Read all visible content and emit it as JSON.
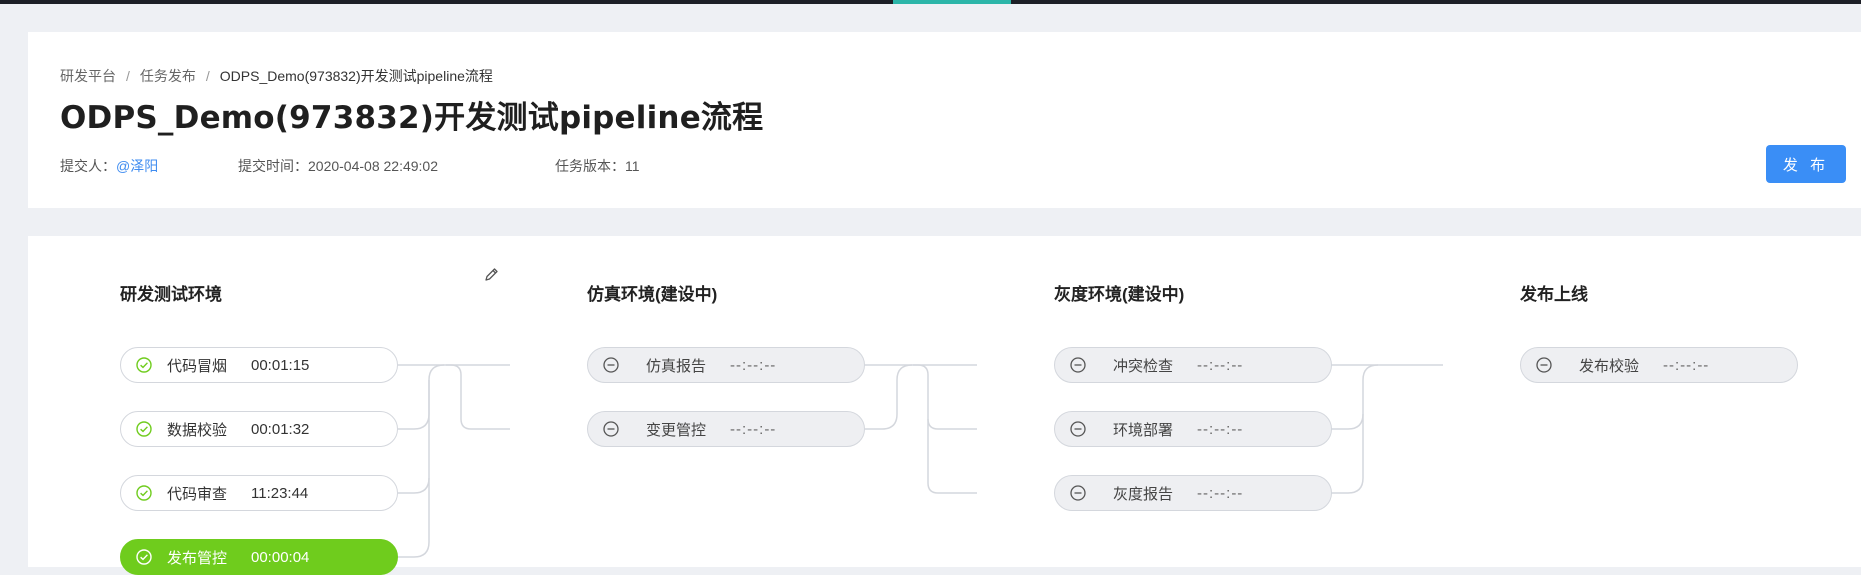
{
  "breadcrumb": {
    "items": [
      "研发平台",
      "任务发布"
    ],
    "separator": "/",
    "current": "ODPS_Demo(973832)开发测试pipeline流程"
  },
  "page": {
    "title": "ODPS_Demo(973832)开发测试pipeline流程"
  },
  "meta": {
    "submitter_label": "提交人：",
    "submitter": "@泽阳",
    "submit_time_label": "提交时间：",
    "submit_time": "2020-04-08 22:49:02",
    "version_label": "任务版本：",
    "version": "11"
  },
  "actions": {
    "publish_label": "发 布"
  },
  "colors": {
    "accent": "#3a8ef6",
    "success": "#6fcc1d",
    "link": "#3f8cf0"
  },
  "stages": [
    {
      "title": "研发测试环境",
      "jobs": [
        {
          "name": "代码冒烟",
          "time": "00:01:15",
          "status": "done",
          "icon": "check-circle-icon"
        },
        {
          "name": "数据校验",
          "time": "00:01:32",
          "status": "done",
          "icon": "check-circle-icon"
        },
        {
          "name": "代码审查",
          "time": "11:23:44",
          "status": "done",
          "icon": "check-circle-icon"
        },
        {
          "name": "发布管控",
          "time": "00:00:04",
          "status": "active",
          "icon": "check-circle-icon"
        }
      ]
    },
    {
      "title": "仿真环境(建设中)",
      "jobs": [
        {
          "name": "仿真报告",
          "time": "--:--:--",
          "status": "pending",
          "icon": "minus-circle-icon"
        },
        {
          "name": "变更管控",
          "time": "--:--:--",
          "status": "pending",
          "icon": "minus-circle-icon"
        }
      ]
    },
    {
      "title": "灰度环境(建设中)",
      "jobs": [
        {
          "name": "冲突检查",
          "time": "--:--:--",
          "status": "pending",
          "icon": "minus-circle-icon"
        },
        {
          "name": "环境部署",
          "time": "--:--:--",
          "status": "pending",
          "icon": "minus-circle-icon"
        },
        {
          "name": "灰度报告",
          "time": "--:--:--",
          "status": "pending",
          "icon": "minus-circle-icon"
        }
      ]
    },
    {
      "title": "发布上线",
      "jobs": [
        {
          "name": "发布校验",
          "time": "--:--:--",
          "status": "pending",
          "icon": "minus-circle-icon"
        }
      ]
    }
  ]
}
